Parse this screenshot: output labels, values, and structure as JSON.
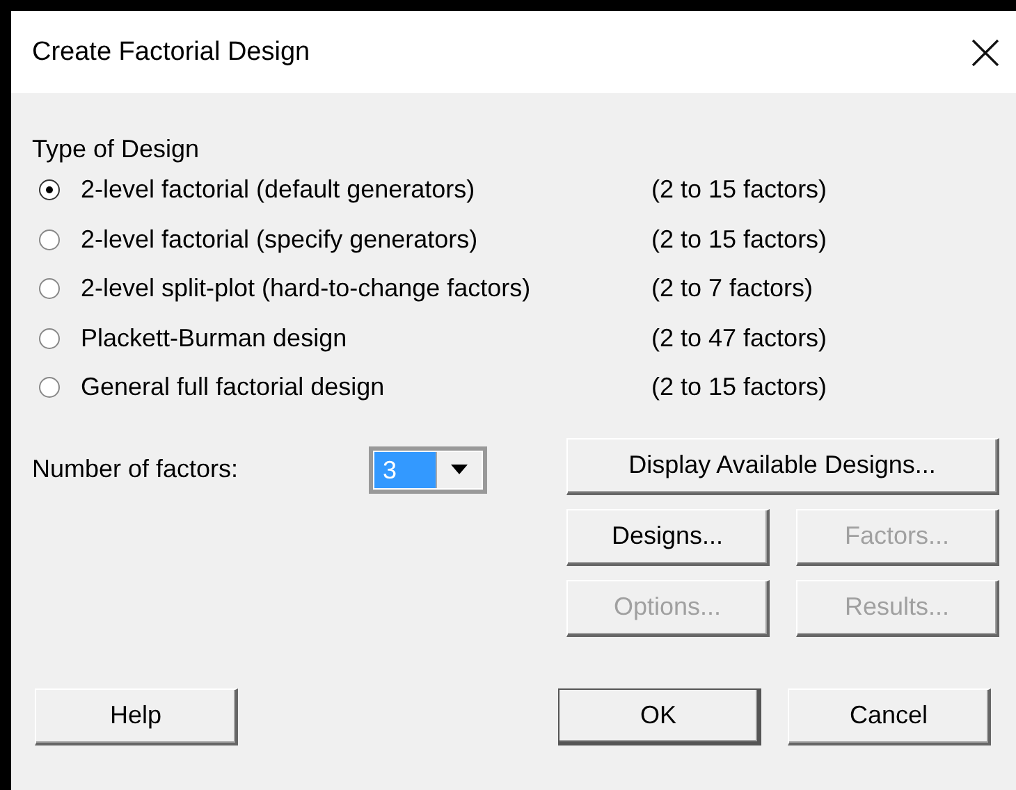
{
  "window": {
    "title": "Create Factorial Design"
  },
  "type_of_design": {
    "label": "Type of Design",
    "options": [
      {
        "label": "2-level factorial (default generators)",
        "range": "(2 to 15 factors)",
        "selected": true
      },
      {
        "label": "2-level factorial (specify generators)",
        "range": "(2 to 15 factors)",
        "selected": false
      },
      {
        "label": "2-level split-plot (hard-to-change factors)",
        "range": "(2 to 7 factors)",
        "selected": false
      },
      {
        "label": "Plackett-Burman design",
        "range": "(2 to 47 factors)",
        "selected": false
      },
      {
        "label": "General full factorial design",
        "range": "(2 to 15 factors)",
        "selected": false
      }
    ]
  },
  "number_of_factors": {
    "label": "Number of factors:",
    "value": "3"
  },
  "design_buttons": [
    {
      "label": "Display Available Designs...",
      "disabled": false
    },
    {
      "label": "Designs...",
      "disabled": false
    },
    {
      "label": "Factors...",
      "disabled": true
    },
    {
      "label": "Options...",
      "disabled": true
    },
    {
      "label": "Results...",
      "disabled": true
    }
  ],
  "footer_buttons": [
    {
      "label": "Help",
      "default": false
    },
    {
      "label": "OK",
      "default": true
    },
    {
      "label": "Cancel",
      "default": false
    }
  ]
}
